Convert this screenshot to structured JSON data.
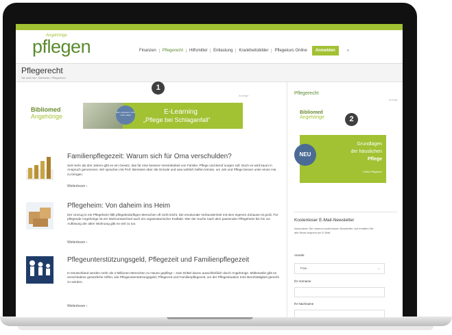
{
  "header": {
    "logo_small": "Angehörige",
    "logo": "pflegen",
    "nav": [
      "Finanzen",
      "Pflegerecht",
      "Hilfsmittel",
      "Entlastung",
      "Krankheitsbilder",
      "Pflegekurs Online"
    ],
    "login_label": "Anmelden",
    "search_icon": "⌕"
  },
  "page": {
    "title": "Pflegerecht",
    "breadcrumb": "Sie sind hier: Startseite / Pflegerecht"
  },
  "badges": {
    "one": "1",
    "two": "2"
  },
  "ad": {
    "tag": "Anzeige",
    "brand_1": "Bibliomed",
    "brand_2": "Angehörige",
    "circle_text": "Das „Anwesen“ nicht mehr erlebt",
    "line1": "E-Learning",
    "line2": "„Pflege bei Schlaganfall“"
  },
  "posts": [
    {
      "title": "Familienpflegezeit: Warum sich für Oma verschulden?",
      "excerpt": "Seit mehr als drei Jahren gibt es ein Gesetz, das für eine bessere Vereinbarkeit von Familie, Pflege und Beruf sorgen soll. Doch es wird kaum in Anspruch genommen. Wir sprachen mit Prof. Bienstein über die Gründe und was wirklich helfen könnte, um Job und Pflege besser unter einen Hut zu bringen.",
      "more": "Weiterlesen  ›"
    },
    {
      "title": "Pflegeheim: Von daheim ins Heim",
      "excerpt": "Der Umzug in ein Pflegeheim fällt pflegebedürftigen Menschen oft nicht leicht. Die emotionale Verbundenheit mit dem eigenen Zuhause ist groß. Für pflegende Angehörige ist ein Wohnortwechsel auch ein organisatorischer Kraftakt. Wer der Suche nach dem passenden Pflegeheim bis hin zur Auflösung der alten Wohnung gibt es viel zu tun.",
      "more": "Weiterlesen  ›"
    },
    {
      "title": "Pflegeunterstützungsgeld, Pflegezeit und Familienpflegezeit",
      "excerpt": "In Deutschland werden mehr als 2 Millionen Menschen zu Hause gepflegt – zwei Drittel davon ausschließlich durch Angehörige. Mittlerweile gibt es verschiedene gesetzliche Hilfen, wie Pflegeunterstützungsgeld, Pflegezeit und Familienpflegezeit, um der Pflegesituation trotz Berufstätigkeit gerecht zu werden.",
      "more": "Weiterlesen  ›"
    }
  ],
  "sidebar": {
    "title": "Pflegerecht",
    "ad_tag": "Anzeige",
    "brand_1": "Bibliomed",
    "brand_2": "Angehörige",
    "neu": "NEU",
    "ad_line1": "Grundlagen",
    "ad_line2": "der häuslichen",
    "ad_line3": "Pflege",
    "ad_small": "Online-Pflegekurs",
    "newsletter_title": "Kostenloser E-Mail-Newsletter",
    "newsletter_text": "Abonnieren Sie unseren kostenlosen Newsletter und erhalten Sie alle News bequem per E-Mail.",
    "label_anrede": "Anrede",
    "anrede_value": "Frau",
    "label_vorname": "Ihr Vorname",
    "label_nachname": "Ihr Nachname"
  },
  "colors": {
    "brand": "#a2c133",
    "brand_dark": "#5a8a2e",
    "badge": "#3f3f3f"
  }
}
